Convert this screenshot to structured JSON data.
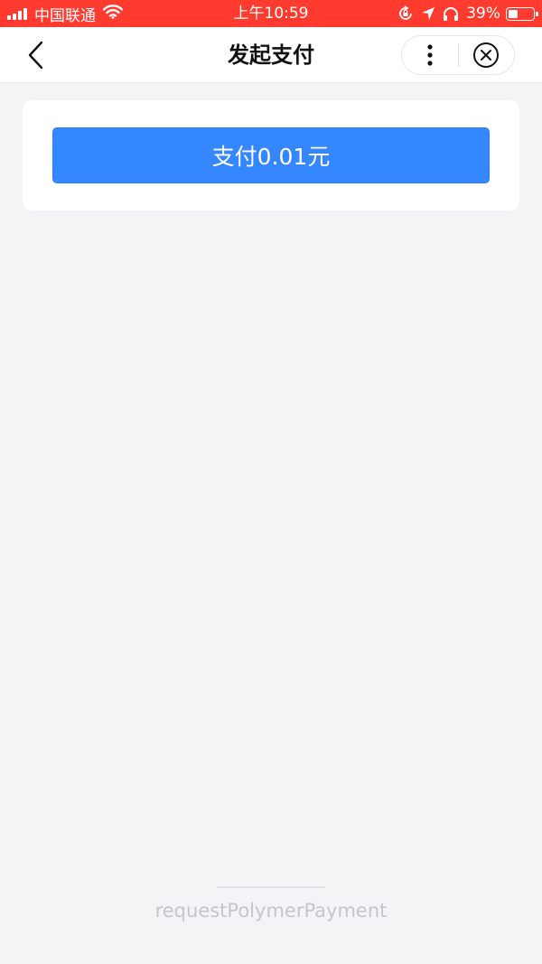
{
  "status_bar": {
    "carrier": "中国联通",
    "time": "上午10:59",
    "battery": "39%",
    "battery_level": 0.39,
    "icons": [
      "signal-icon",
      "wifi-icon",
      "rotation-lock-icon",
      "location-arrow-icon",
      "headphones-icon",
      "battery-icon"
    ]
  },
  "nav": {
    "title": "发起支付",
    "icons": [
      "back-chevron-icon",
      "more-dots-icon",
      "close-circle-icon"
    ]
  },
  "main": {
    "pay_button_label": "支付0.01元"
  },
  "footer": {
    "api_name": "requestPolymerPayment"
  },
  "colors": {
    "status_bar_bg": "#ff3b30",
    "accent": "#3487ff",
    "page_bg": "#f4f3f6"
  }
}
